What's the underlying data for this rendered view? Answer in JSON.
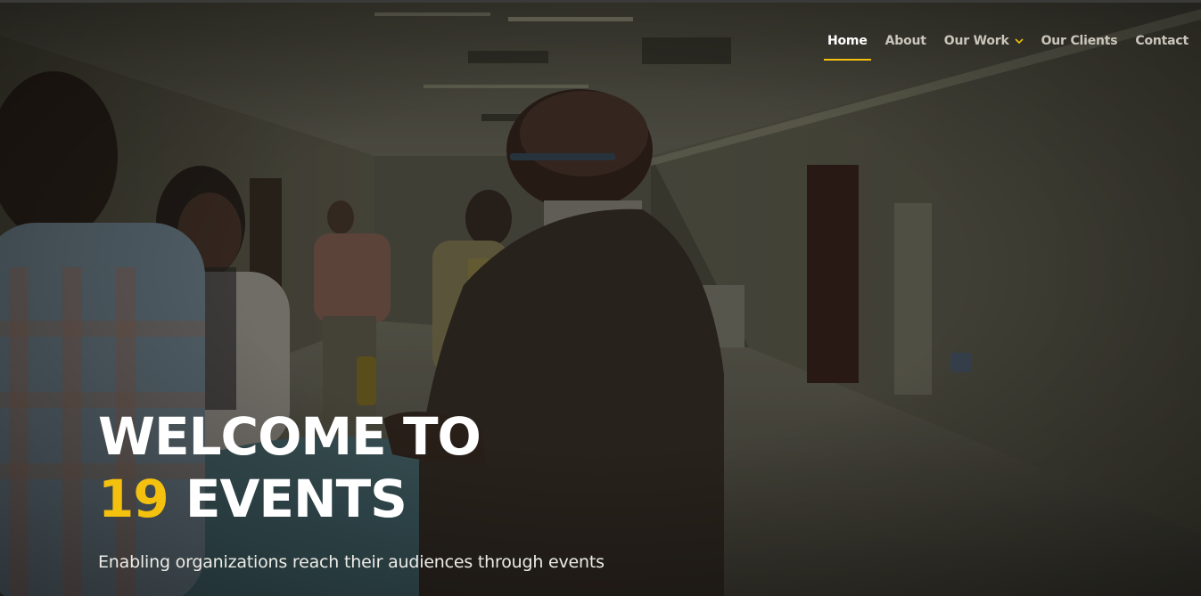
{
  "nav": {
    "items": [
      {
        "label": "Home",
        "active": true
      },
      {
        "label": "About",
        "active": false
      },
      {
        "label": "Our Work",
        "active": false,
        "has_dropdown": true
      },
      {
        "label": "Our Clients",
        "active": false
      },
      {
        "label": "Contact",
        "active": false
      }
    ]
  },
  "hero": {
    "headline_line1": "WELCOME TO",
    "headline_number": "19",
    "headline_word": " EVENTS",
    "tagline": "Enabling organizations reach their audiences through events",
    "background_image": "people-networking-in-corridor"
  },
  "colors": {
    "accent": "#f4c10f",
    "text": "#ffffff",
    "nav_text": "#c9c5bb",
    "overlay": "#1e1d19"
  },
  "icons": {
    "dropdown": "chevron-down-icon"
  }
}
